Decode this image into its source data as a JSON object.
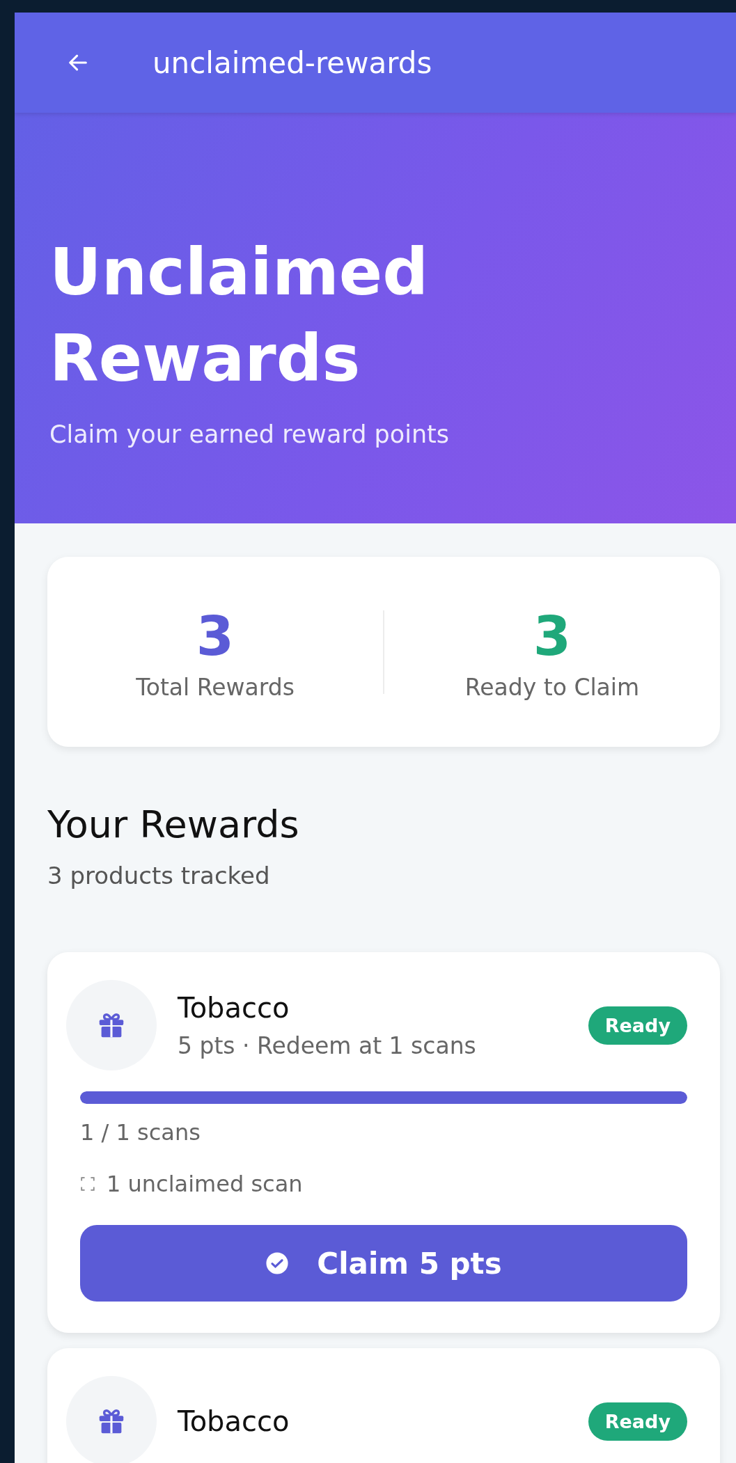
{
  "app_bar": {
    "title": "unclaimed-rewards"
  },
  "hero": {
    "title": "Unclaimed Rewards",
    "subtitle": "Claim your earned reward points"
  },
  "stats": [
    {
      "value": "3",
      "label": "Total Rewards",
      "color": "#5b5bd6"
    },
    {
      "value": "3",
      "label": "Ready to Claim",
      "color": "#1fa87a"
    }
  ],
  "section": {
    "title": "Your Rewards",
    "subtitle": "3 products tracked"
  },
  "rewards": [
    {
      "name": "Tobacco",
      "details": "5 pts · Redeem at 1 scans",
      "badge": "Ready",
      "level": 1,
      "progress_text": "1 / 1 scans",
      "unclaimed_text": "1 unclaimed scan",
      "button": "Claim 5 pts"
    },
    {
      "name": "Tobacco",
      "badge": "Ready"
    }
  ]
}
